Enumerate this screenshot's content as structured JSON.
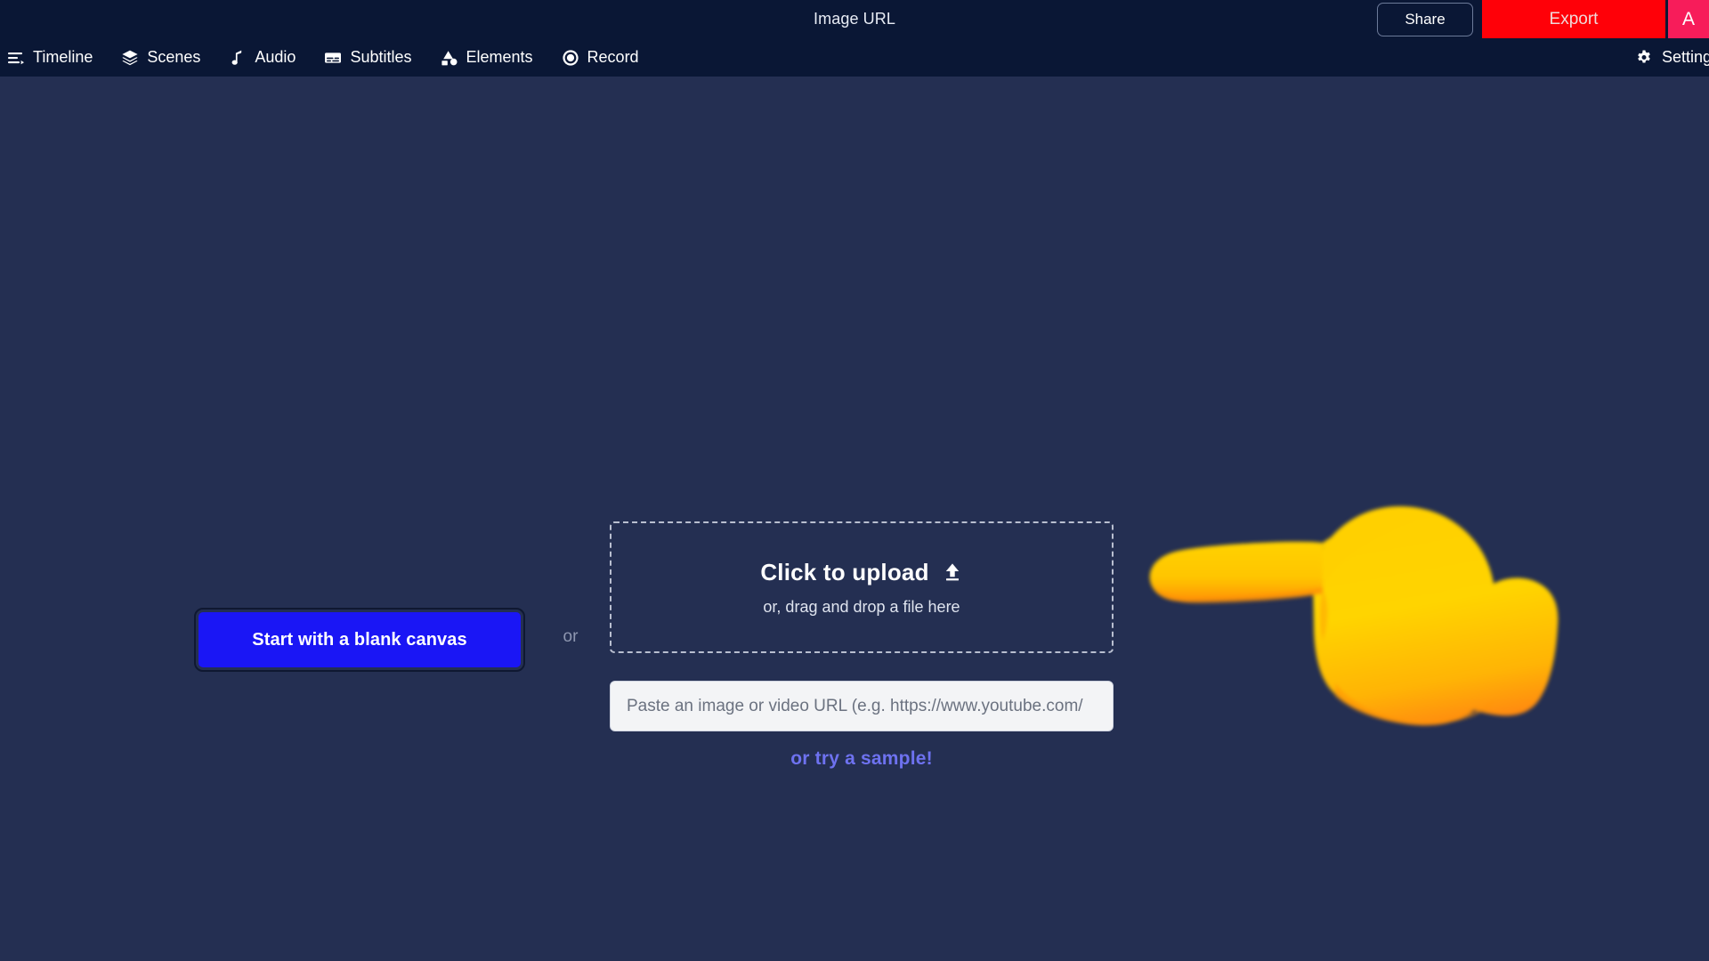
{
  "topbar": {
    "doc_title": "Image URL",
    "share_label": "Share",
    "export_label": "Export",
    "avatar_initial": "A",
    "export_color": "#ff0008",
    "avatar_color": "#f71c5a",
    "background": "#0a1735"
  },
  "navbar": {
    "items": [
      {
        "label": "Timeline",
        "icon": "timeline-icon"
      },
      {
        "label": "Scenes",
        "icon": "layers-icon"
      },
      {
        "label": "Audio",
        "icon": "music-note-icon"
      },
      {
        "label": "Subtitles",
        "icon": "subtitles-icon"
      },
      {
        "label": "Elements",
        "icon": "shapes-icon"
      },
      {
        "label": "Record",
        "icon": "record-circle-icon"
      }
    ],
    "settings_label": "Settings",
    "settings_icon": "gear-icon"
  },
  "stage": {
    "background": "#242f52",
    "blank_canvas_label": "Start with a blank canvas",
    "blank_canvas_color": "#1a16f5",
    "or_label": "or",
    "upload": {
      "headline": "Click to upload",
      "icon": "upload-arrow-icon",
      "subtext": "or, drag and drop a file here"
    },
    "url_field": {
      "placeholder": "Paste an image or video URL (e.g. https://www.youtube.com/",
      "value": ""
    },
    "sample_link_label": "or try a sample!",
    "sample_link_color": "#6e72f0",
    "pointer_emoji": {
      "icon": "backhand-index-pointing-left-emoji",
      "color": "#ffc800"
    }
  }
}
